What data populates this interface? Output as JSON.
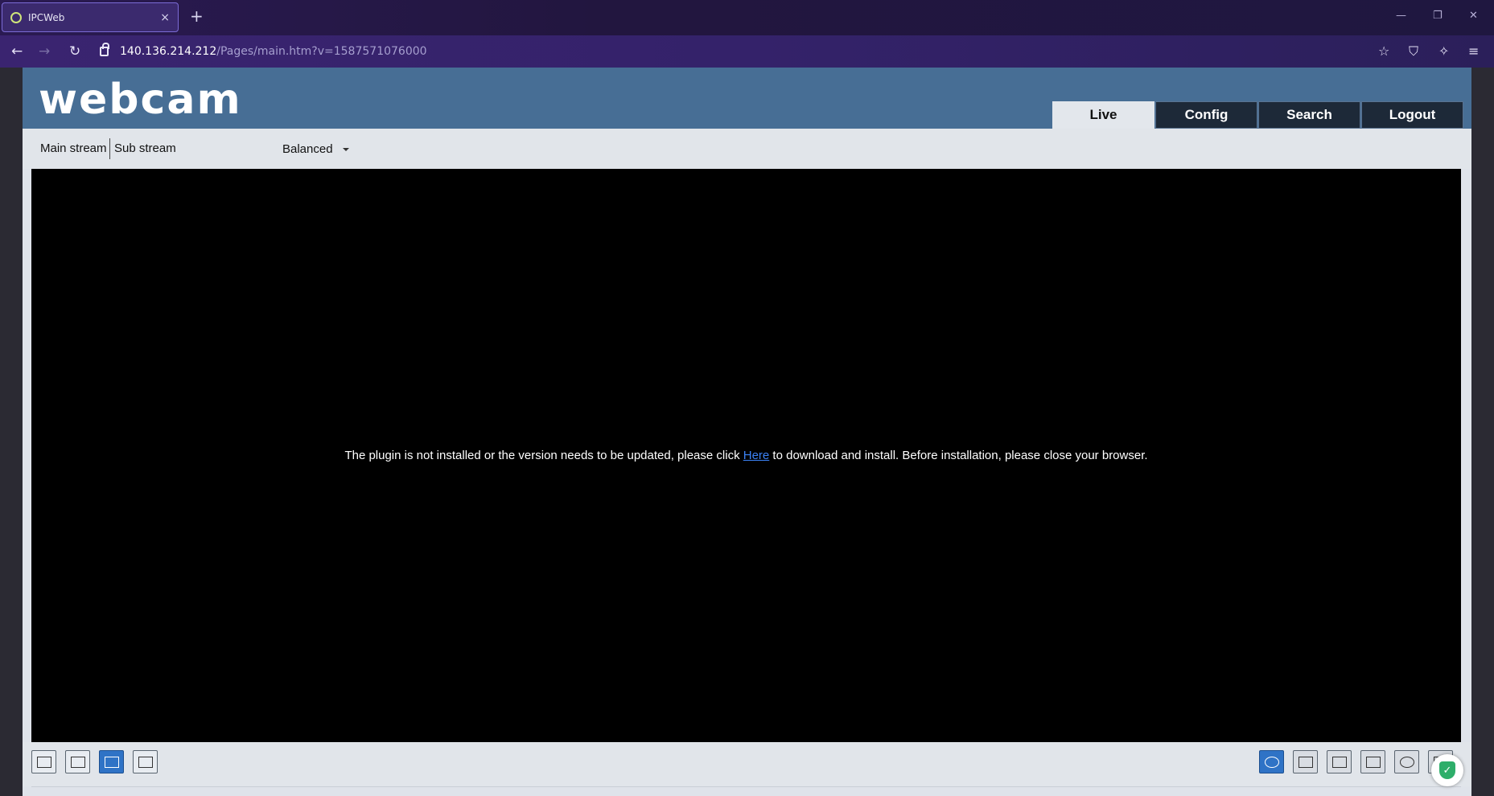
{
  "browser": {
    "tab_title": "IPCWeb",
    "tab_close": "×",
    "new_tab": "+",
    "url_host": "140.136.214.212",
    "url_path": "/Pages/main.htm?v=1587571076000"
  },
  "app": {
    "logo": "webcam",
    "tabs": [
      {
        "label": "Live"
      },
      {
        "label": "Config"
      },
      {
        "label": "Search"
      },
      {
        "label": "Logout"
      }
    ],
    "active_tab": "Live",
    "streams": {
      "main": "Main stream",
      "sub": "Sub stream"
    },
    "quality": "Balanced",
    "plugin": {
      "before": "The plugin is not installed or the version needs to be updated, please click ",
      "link": "Here",
      "after": " to download and install. Before installation, please close your browser."
    }
  },
  "colors": {
    "header": "#476e95",
    "tab_dark": "#1d2938",
    "active_tool": "#2f73c6",
    "link": "#3b82f6"
  }
}
